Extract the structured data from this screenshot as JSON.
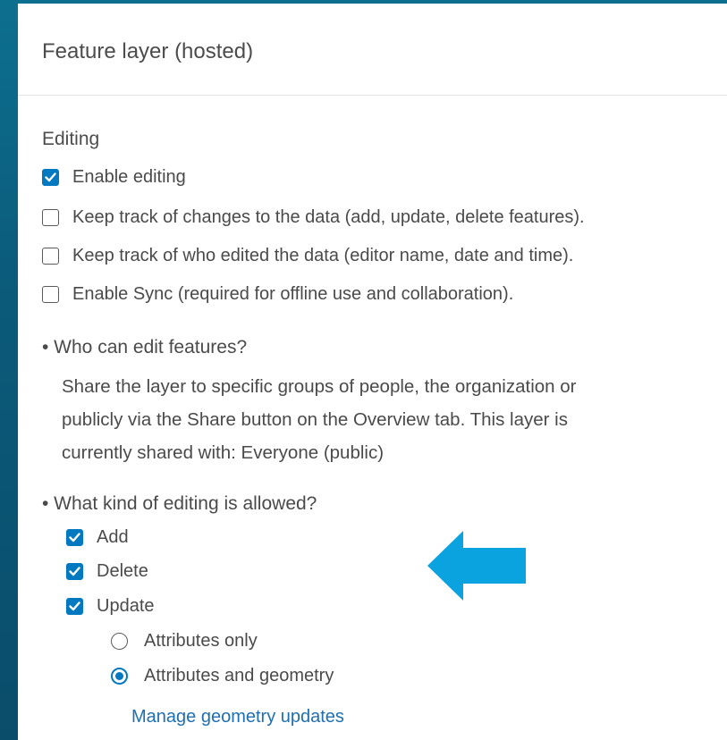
{
  "panel": {
    "title": "Feature layer (hosted)"
  },
  "editing": {
    "section_title": "Editing",
    "options": [
      {
        "label": "Enable editing",
        "checked": true
      },
      {
        "label": "Keep track of changes to the data (add, update, delete features).",
        "checked": false
      },
      {
        "label": "Keep track of who edited the data (editor name, date and time).",
        "checked": false
      },
      {
        "label": "Enable Sync (required for offline use and collaboration).",
        "checked": false
      }
    ]
  },
  "who_can_edit": {
    "question": "• Who can edit features?",
    "lines": [
      "Share the layer to specific groups of people, the organization or",
      "publicly via the Share button on the Overview tab. This layer is",
      "currently shared with: Everyone (public)"
    ]
  },
  "editing_allowed": {
    "question": "• What kind of editing is allowed?",
    "options": [
      {
        "label": "Add",
        "checked": true
      },
      {
        "label": "Delete",
        "checked": true
      },
      {
        "label": "Update",
        "checked": true
      }
    ],
    "update_modes": [
      {
        "label": "Attributes only",
        "selected": false
      },
      {
        "label": "Attributes and geometry",
        "selected": true
      }
    ],
    "manage_link": "Manage geometry updates"
  },
  "annotation": {
    "arrow_color": "#0aa3df",
    "arrow_icon": "left-arrow-icon"
  },
  "colors": {
    "accent": "#0079c1",
    "background": "#0b5a7a"
  }
}
